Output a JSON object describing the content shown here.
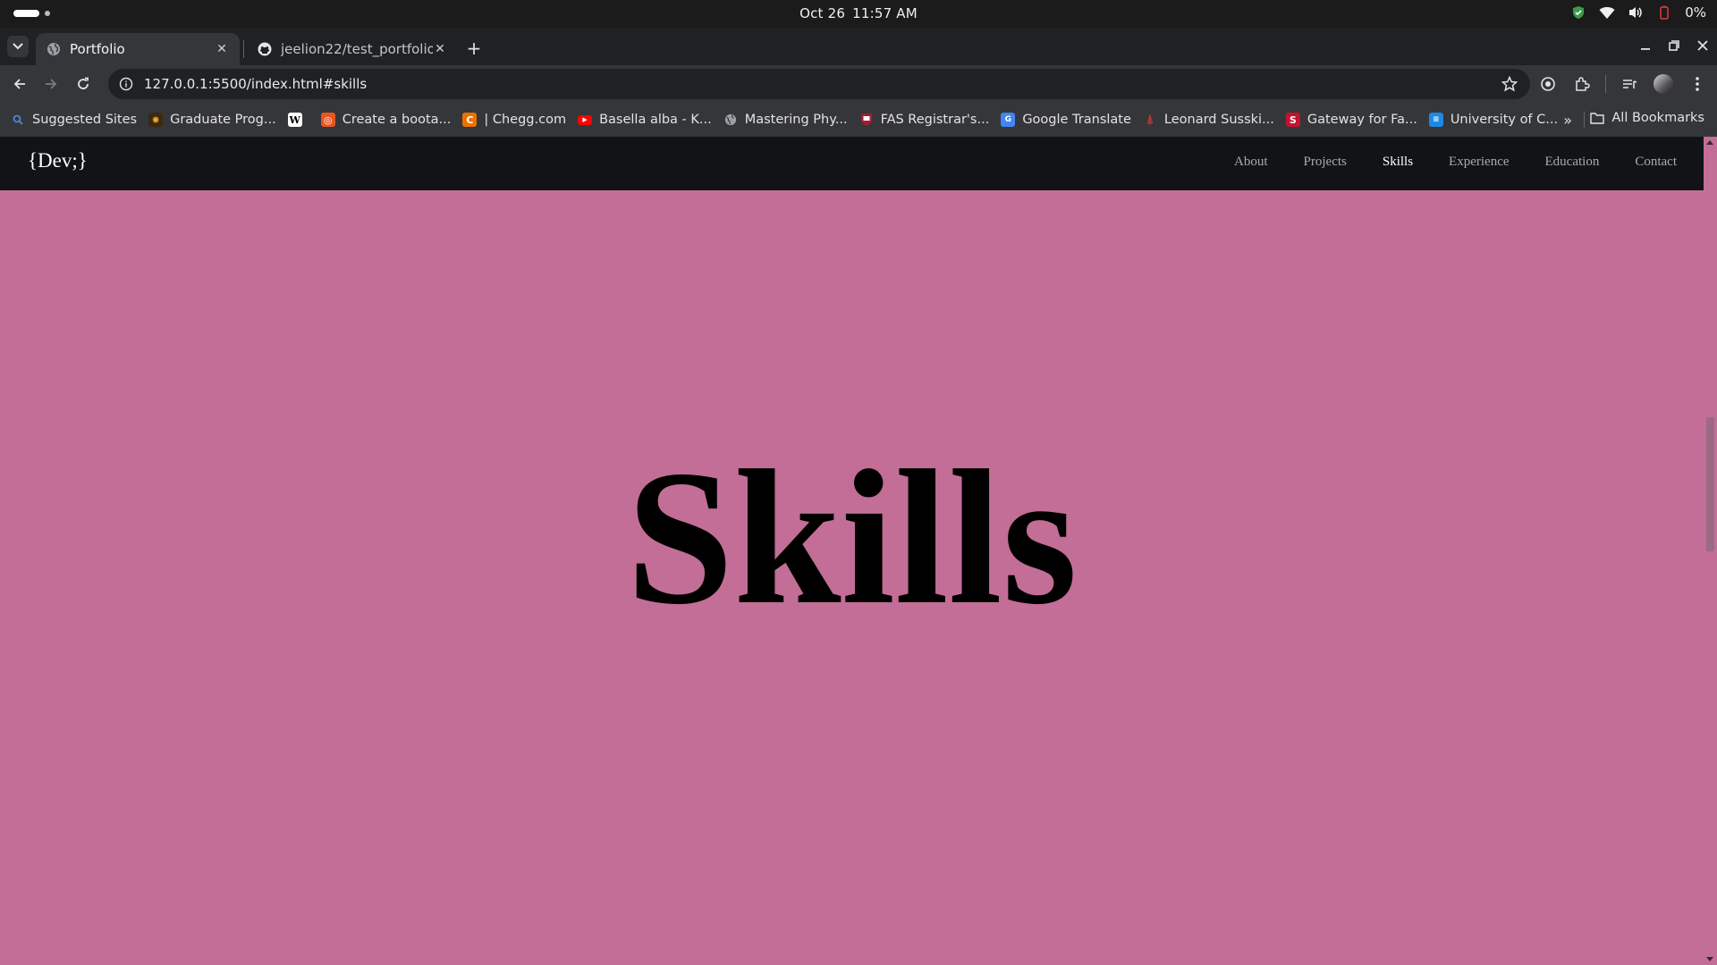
{
  "system": {
    "date": "Oct 26",
    "time": "11:57 AM",
    "battery_percent": "0%",
    "icons": [
      "shield-icon",
      "wifi-icon",
      "volume-icon",
      "battery-icon"
    ]
  },
  "tabs": [
    {
      "title": "Portfolio",
      "active": true,
      "icon": "globe-icon"
    },
    {
      "title": "jeelion22/test_portfolio",
      "active": false,
      "icon": "github-icon"
    }
  ],
  "toolbar": {
    "url": "127.0.0.1:5500/index.html#skills"
  },
  "bookmarks": [
    {
      "label": "Suggested Sites",
      "icon": "search-icon",
      "color": "#4a90e2"
    },
    {
      "label": "Graduate Prog...",
      "icon": "university-icon",
      "color": "#f0a030"
    },
    {
      "label": "",
      "icon": "wikipedia-icon",
      "color": "#ffffff"
    },
    {
      "label": "Create a boota...",
      "icon": "ubuntu-icon",
      "color": "#e95420"
    },
    {
      "label": "| Chegg.com",
      "icon": "chegg-icon",
      "color": "#eb7100"
    },
    {
      "label": "Basella alba - K...",
      "icon": "youtube-icon",
      "color": "#ff0000"
    },
    {
      "label": "Mastering Phy...",
      "icon": "globe-icon",
      "color": "#9aa0a6"
    },
    {
      "label": "FAS Registrar's...",
      "icon": "harvard-shield-icon",
      "color": "#a51c30"
    },
    {
      "label": "Google Translate",
      "icon": "translate-icon",
      "color": "#4285f4"
    },
    {
      "label": "Leonard Susski...",
      "icon": "stanford-icon",
      "color": "#8c1515"
    },
    {
      "label": "Gateway for Fa...",
      "icon": "s-logo-icon",
      "color": "#c4122f"
    },
    {
      "label": "University of C...",
      "icon": "university-c-icon",
      "color": "#1e88e5"
    }
  ],
  "bookmarks_all": "All Bookmarks",
  "site": {
    "brand": "{Dev;}",
    "nav": [
      {
        "label": "About",
        "active": false
      },
      {
        "label": "Projects",
        "active": false
      },
      {
        "label": "Skills",
        "active": true
      },
      {
        "label": "Experience",
        "active": false
      },
      {
        "label": "Education",
        "active": false
      },
      {
        "label": "Contact",
        "active": false
      }
    ],
    "hero_title": "Skills",
    "background_color": "#c26e96"
  }
}
